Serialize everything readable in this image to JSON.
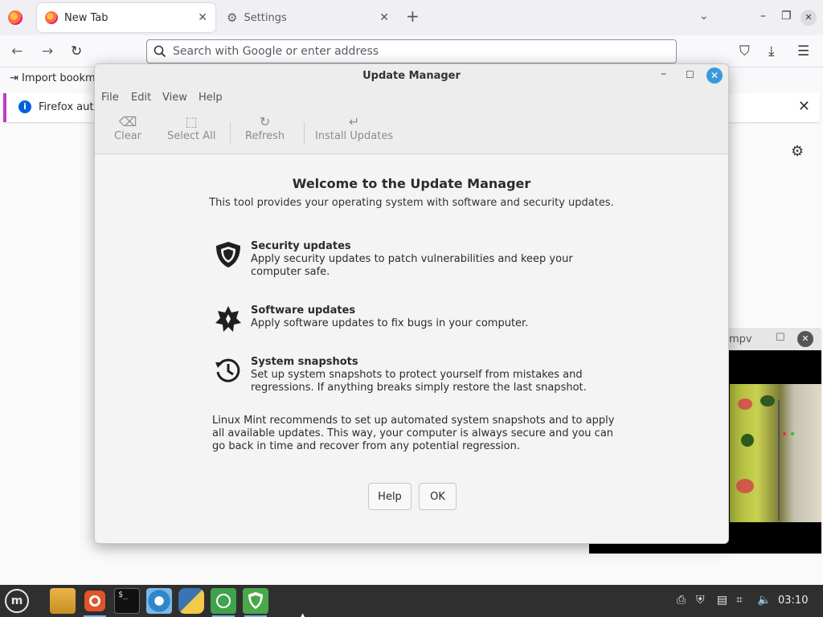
{
  "browser": {
    "tabs": [
      {
        "label": "New Tab",
        "active": true
      },
      {
        "label": "Settings",
        "active": false
      }
    ],
    "address_placeholder": "Search with Google or enter address",
    "bookmarks_label": "Import bookm",
    "notification_text": "Firefox auto"
  },
  "mpv": {
    "title": "mpv"
  },
  "dialog": {
    "title": "Update Manager",
    "menu": [
      "File",
      "Edit",
      "View",
      "Help"
    ],
    "toolbar": {
      "clear": "Clear",
      "select_all": "Select All",
      "refresh": "Refresh",
      "install": "Install Updates"
    },
    "welcome_title": "Welcome to the Update Manager",
    "welcome_subtitle": "This tool provides your operating system with software and security updates.",
    "features": [
      {
        "title": "Security updates",
        "desc": "Apply security updates to patch vulnerabilities and keep your computer safe.",
        "icon": "shield-icon"
      },
      {
        "title": "Software updates",
        "desc": "Apply software updates to fix bugs in your computer.",
        "icon": "gear-star-icon"
      },
      {
        "title": "System snapshots",
        "desc": "Set up system snapshots to protect yourself from mistakes and regressions. If anything breaks simply restore the last snapshot.",
        "icon": "history-icon"
      }
    ],
    "note": "Linux Mint recommends to set up automated system snapshots and to apply all available updates. This way, your computer is always secure and you can go back in time and recover from any potential regression.",
    "help_button": "Help",
    "ok_button": "OK"
  },
  "taskbar": {
    "clock": "03:10",
    "apps": [
      "files-icon",
      "firefox-icon",
      "terminal-icon",
      "app-icon",
      "python-icon",
      "spreadsheet-icon",
      "update-manager-icon"
    ]
  },
  "colors": {
    "accent": "#3a9ad9",
    "notification_border": "#c13ec1",
    "taskbar": "#2f2f2f"
  }
}
